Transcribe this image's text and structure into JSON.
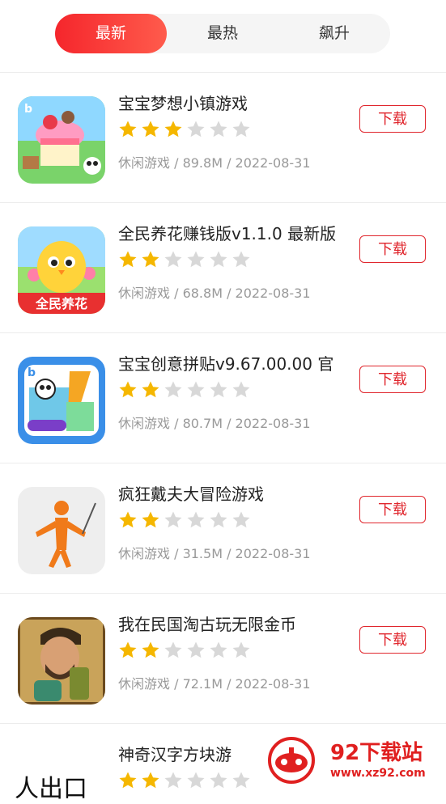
{
  "tabs": [
    {
      "label": "最新",
      "active": true
    },
    {
      "label": "最热",
      "active": false
    },
    {
      "label": "飙升",
      "active": false
    }
  ],
  "download_label": "下载",
  "items": [
    {
      "name": "宝宝梦想小镇游戏",
      "rating": 3,
      "meta": "休闲游戏 / 89.8M / 2022-08-31",
      "icon": "dream-town-icon"
    },
    {
      "name": "全民养花赚钱版v1.1.0 最新版",
      "rating": 2,
      "meta": "休闲游戏 / 68.8M / 2022-08-31",
      "icon": "flower-chick-icon",
      "icon_text": "全民养花"
    },
    {
      "name": "宝宝创意拼贴v9.67.00.00 官",
      "rating": 2,
      "meta": "休闲游戏 / 80.7M / 2022-08-31",
      "icon": "collage-panda-icon"
    },
    {
      "name": "疯狂戴夫大冒险游戏",
      "rating": 2,
      "meta": "休闲游戏 / 31.5M / 2022-08-31",
      "icon": "stickman-icon"
    },
    {
      "name": "我在民国淘古玩无限金币",
      "rating": 2,
      "meta": "休闲游戏 / 72.1M / 2022-08-31",
      "icon": "antique-man-icon"
    },
    {
      "name": "神奇汉字方块游",
      "rating": 2,
      "meta": "",
      "icon": "hanzi-block-icon"
    }
  ],
  "watermark": {
    "title": "92下载站",
    "url": "www.xz92.com"
  },
  "partial_glyphs": "人出口",
  "colors": {
    "accent": "#e0262d",
    "star_on": "#f5b700",
    "star_off": "#d8d8d8"
  }
}
